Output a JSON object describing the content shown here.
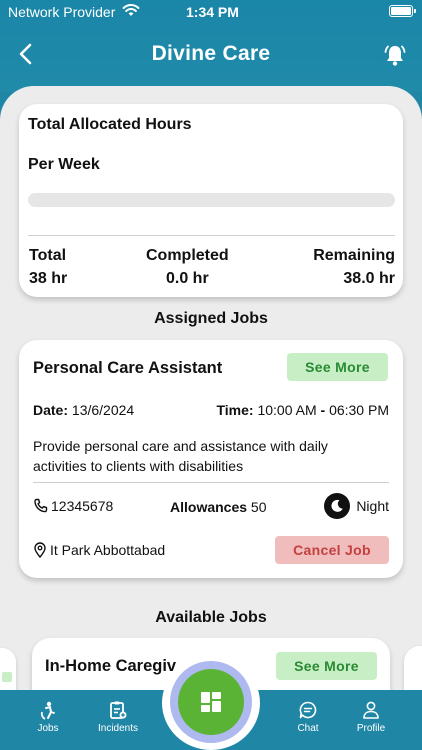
{
  "status_bar": {
    "carrier": "Network Provider",
    "time": "1:34 PM"
  },
  "header": {
    "title": "Divine Care"
  },
  "hours_card": {
    "title": "Total Allocated Hours",
    "subtitle": "Per Week",
    "progress": 0.0,
    "total_label": "Total",
    "total_value": "38 hr",
    "completed_label": "Completed",
    "completed_value": "0.0 hr",
    "remaining_label": "Remaining",
    "remaining_value": "38.0 hr"
  },
  "assigned_section": {
    "title": "Assigned Jobs"
  },
  "assigned_job": {
    "title": "Personal Care Assistant",
    "see_more_label": "See More",
    "date_label": "Date:",
    "date_value": "13/6/2024",
    "time_label": "Time:",
    "time_start": "10:00 AM",
    "time_sep": "-",
    "time_end": "06:30 PM",
    "description": "Provide personal care and assistance with daily activities to clients with disabilities",
    "phone": "12345678",
    "allowances_label": "Allowances",
    "allowances_value": "50",
    "shift": "Night",
    "location": "It Park Abbottabad",
    "cancel_label": "Cancel Job"
  },
  "available_section": {
    "title": "Available Jobs"
  },
  "available_job": {
    "title": "In-Home Caregiv",
    "see_more_label": "See More"
  },
  "bottom_nav": {
    "jobs": "Jobs",
    "incidents": "Incidents",
    "chat": "Chat",
    "profile": "Profile"
  },
  "colors": {
    "primary": "#1f86a6",
    "see_more_bg": "#c7eec4",
    "see_more_text": "#2a8a34",
    "cancel_bg": "#f0bcbc",
    "cancel_text": "#c44040",
    "fab": "#5bb336"
  }
}
